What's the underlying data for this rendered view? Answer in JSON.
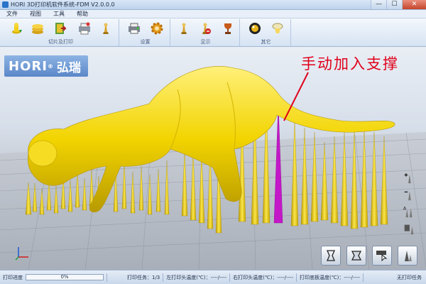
{
  "window": {
    "title": "HORI 3D打印机软件系统-FDM V2.0.0.0",
    "minimize_glyph": "—",
    "maximize_glyph": "☐",
    "close_glyph": "✕"
  },
  "menu": {
    "items": [
      "文件",
      "视图",
      "工具",
      "帮助"
    ]
  },
  "ribbon": {
    "groups": [
      {
        "label": "切片及打印",
        "buttons": [
          "load-model-icon",
          "layer-stack-icon",
          "export-icon",
          "print-queue-icon",
          "chess-piece-icon"
        ]
      },
      {
        "label": "设置",
        "buttons": [
          "printer-settings-icon",
          "gear-icon"
        ]
      },
      {
        "label": "显示",
        "buttons": [
          "model-view-icon",
          "support-view-icon",
          "trophy-icon"
        ]
      },
      {
        "label": "其它",
        "buttons": [
          "preview-icon",
          "help-icon"
        ]
      }
    ]
  },
  "viewport": {
    "logo": {
      "latin": "HORI",
      "registered": "®",
      "chinese": "弘瑞"
    },
    "annotation": "手动加入支撑",
    "side_tools": [
      "add-support-icon",
      "remove-support-icon",
      "auto-support-icon",
      "support-list-icon"
    ],
    "bottom_tools": [
      "center-model-icon",
      "scale-model-icon",
      "view-select-icon",
      "support-mode-icon"
    ],
    "colors": {
      "model": "#f0d400",
      "support": "#f2d800",
      "manual_support": "#c317c8",
      "annotation": "#e0001a"
    }
  },
  "status": {
    "progress_label": "打印进度",
    "progress_value": "0%",
    "progress_fraction": 0,
    "task": "打印任务：1/3",
    "left_temp": "左打印头温度(℃)：----/----",
    "right_temp": "右打印头温度(℃)：----/----",
    "bed_temp": "打印底板温度(℃)：----/----",
    "state": "无打印任务"
  }
}
